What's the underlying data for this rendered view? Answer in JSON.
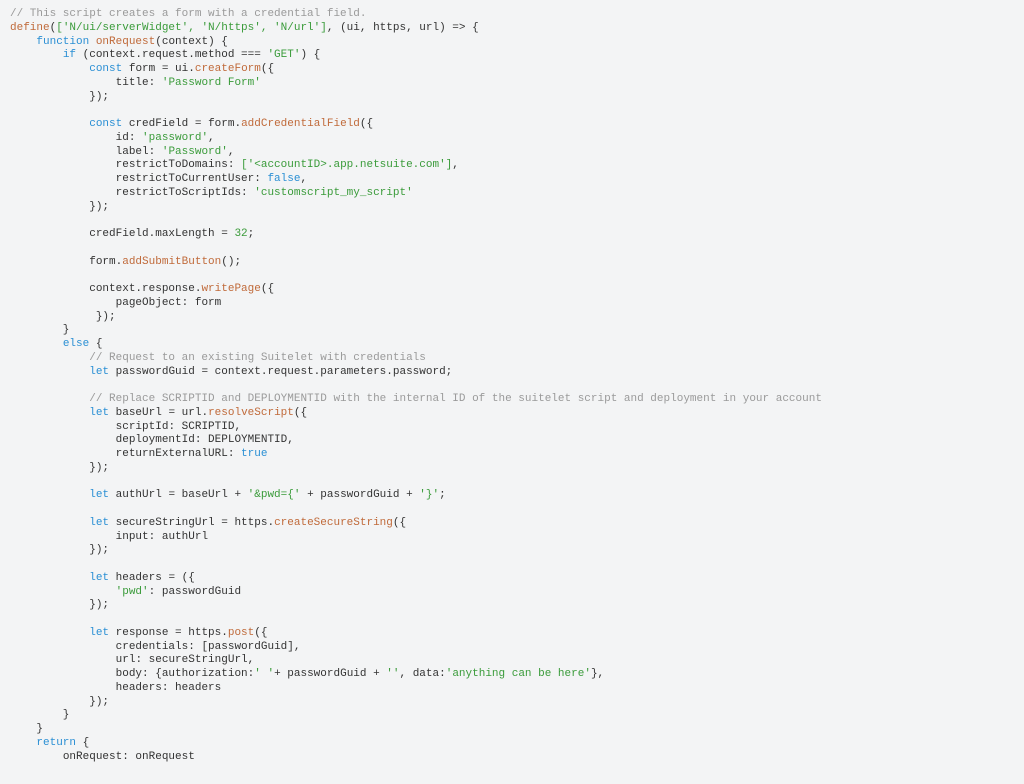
{
  "code": {
    "topComment": "// This script creates a form with a credential field.",
    "defineModules": "['N/ui/serverWidget', 'N/https', 'N/url']",
    "defineParams": "(ui, https, url)",
    "fnKeyword": "function",
    "fnName": "onRequest",
    "fnArg": "context",
    "ifCond": "context.request.method === ",
    "ifGet": "'GET'",
    "constKw": "const",
    "formVar": "form",
    "eq": " = ui.",
    "createForm": "createForm",
    "titleKey": "title",
    "titleVal": "'Password Form'",
    "credVar": "credField",
    "formDot": " = form.",
    "addCred": "addCredentialField",
    "idKey": "id",
    "idVal": "'password'",
    "labelKey": "label",
    "labelVal": "'Password'",
    "domainsKey": "restrictToDomains",
    "domainsVal": "['<accountID>.app.netsuite.com']",
    "currentUserKey": "restrictToCurrentUser",
    "falseVal": "false",
    "scriptIdsKey": "restrictToScriptIds",
    "scriptIdsVal": "'customscript_my_script'",
    "maxLenLine": "credField.maxLength = ",
    "maxLenNum": "32",
    "addSubmit": "addSubmitButton",
    "formAddSubmitPre": "form.",
    "writePagePre": "context.response.",
    "writePage": "writePage",
    "pageObjKey": "pageObject",
    "pageObjVal": "form",
    "elseKw": "else",
    "letKw": "let",
    "comment2": "// Request to an existing Suitelet with credentials",
    "guidLine": " passwordGuid = context.request.parameters.password;",
    "comment3": "// Replace SCRIPTID and DEPLOYMENTID with the internal ID of the suitelet script and deployment in your account",
    "baseUrlVar": " baseUrl = url.",
    "resolveScript": "resolveScript",
    "scriptIdKey": "scriptId",
    "scriptIdVal": "SCRIPTID",
    "deployIdKey": "deploymentId",
    "deployIdVal": "DEPLOYMENTID",
    "returnExtKey": "returnExternalURL",
    "trueVal": "true",
    "authLinePre": " authUrl = baseUrl + ",
    "authStr1": "'&pwd={'",
    "authLineMid": " + passwordGuid + ",
    "authStr2": "'}'",
    "secureVar": " secureStringUrl = https.",
    "createSecure": "createSecureString",
    "inputKey": "input",
    "inputVal": "authUrl",
    "headersVar": " headers = ({",
    "pwdKey": "'pwd'",
    "pwdVal": "passwordGuid",
    "responseVar": " response = https.",
    "postFn": "post",
    "credKey": "credentials",
    "credVal": "[passwordGuid]",
    "urlKey": "url",
    "urlVal": "secureStringUrl",
    "bodyKey": "body",
    "bodyPre": "{authorization:",
    "bodyStr1": "' '",
    "bodyMid": "+ passwordGuid + ",
    "bodyStr2": "''",
    "bodyDataKey": ", data:",
    "bodyDataVal": "'anything can be here'",
    "headersKey": "headers",
    "headersVal": "headers",
    "returnKw": "return",
    "returnLine": "onRequest: onRequest",
    "define": "define"
  }
}
